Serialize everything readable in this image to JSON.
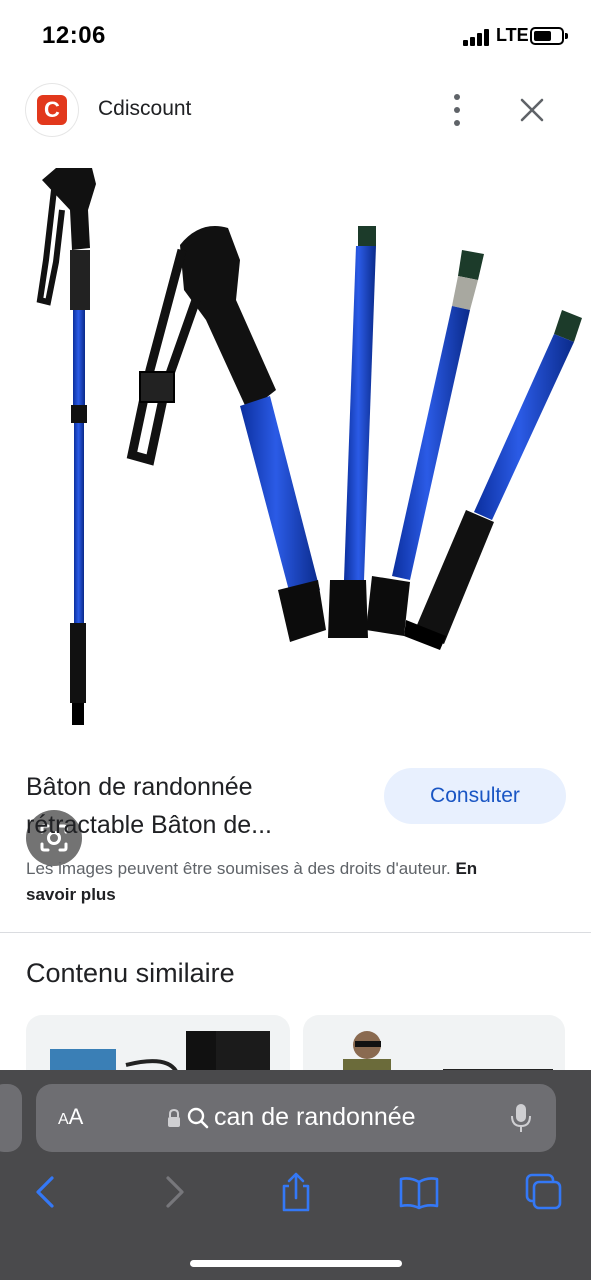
{
  "status_bar": {
    "time": "12:06",
    "network": "LTE",
    "icons": [
      "signal-icon",
      "battery-icon"
    ]
  },
  "source": {
    "logo_letter": "C",
    "logo_color": "#e2381c",
    "name": "Cdiscount",
    "icons": [
      "more-vert-icon",
      "close-icon"
    ]
  },
  "product": {
    "image_alt_icon": "hiking-poles-image",
    "title_line1": "Bâton de randonnée",
    "title_line2": "rétractable Bâton de...",
    "consult_label": "Consulter",
    "accent_color": "#1a56c4"
  },
  "copyright": {
    "text": "Les images peuvent être soumises à des droits d'auteur.",
    "link_part1": "En",
    "link_part2": "savoir plus"
  },
  "similar": {
    "heading": "Contenu similaire"
  },
  "browser": {
    "aa_label_small": "A",
    "aa_label_big": "A",
    "address_text": "can de randonnée",
    "icons": [
      "lock-icon",
      "search-icon",
      "mic-icon",
      "back-icon",
      "forward-icon",
      "share-icon",
      "bookmarks-icon",
      "tabs-icon"
    ]
  }
}
